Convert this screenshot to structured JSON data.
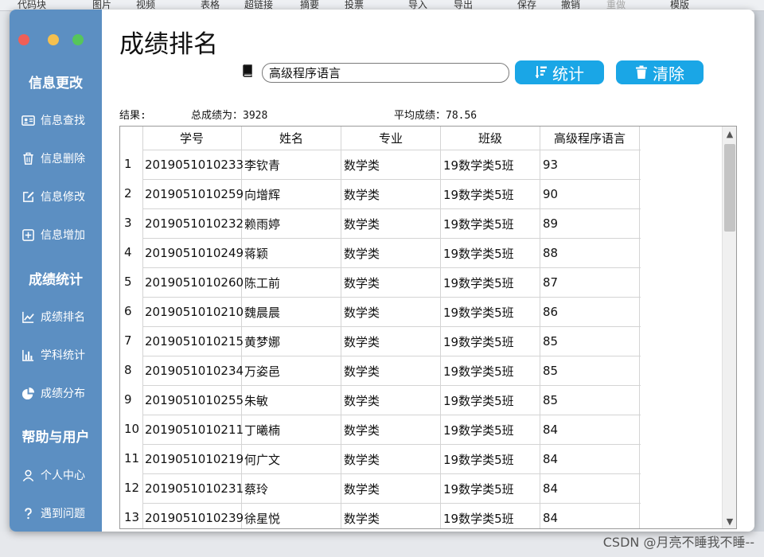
{
  "background": {
    "toolbar_items": [
      "代码块",
      "图片",
      "视频",
      "表格",
      "超链接",
      "摘要",
      "投票",
      "导入",
      "导出",
      "保存",
      "撤销",
      "重做",
      "模版"
    ],
    "watermark": "CSDN @月亮不睡我不睡--"
  },
  "window": {
    "title": "成绩排名",
    "sidebar": {
      "section_info": "信息更改",
      "info_items": [
        {
          "label": "信息查找",
          "icon": "id-card-icon"
        },
        {
          "label": "信息删除",
          "icon": "trash-icon"
        },
        {
          "label": "信息修改",
          "icon": "edit-icon"
        },
        {
          "label": "信息增加",
          "icon": "plus-square-icon"
        }
      ],
      "section_stats": "成绩统计",
      "stats_items": [
        {
          "label": "成绩排名",
          "icon": "line-chart-icon"
        },
        {
          "label": "学科统计",
          "icon": "bar-chart-icon"
        },
        {
          "label": "成绩分布",
          "icon": "pie-chart-icon"
        }
      ],
      "section_help": "帮助与用户",
      "help_items": [
        {
          "label": "个人中心",
          "icon": "user-icon"
        },
        {
          "label": "遇到问题",
          "icon": "question-icon"
        }
      ]
    },
    "toolbar": {
      "subject_value": "高级程序语言",
      "stat_button": "统计",
      "clear_button": "清除"
    },
    "summary": {
      "result_label": "结果:",
      "total_label": "总成绩为：3928",
      "avg_label": "平均成绩：78.56"
    },
    "table": {
      "columns": [
        "学号",
        "姓名",
        "专业",
        "班级",
        "高级程序语言"
      ],
      "rows": [
        {
          "num": "1",
          "id": "2019051010233",
          "name": "李钦青",
          "major": "数学类",
          "class": "19数学类5班",
          "score": "93"
        },
        {
          "num": "2",
          "id": "2019051010259",
          "name": "向增辉",
          "major": "数学类",
          "class": "19数学类5班",
          "score": "90"
        },
        {
          "num": "3",
          "id": "2019051010232",
          "name": "赖雨婷",
          "major": "数学类",
          "class": "19数学类5班",
          "score": "89"
        },
        {
          "num": "4",
          "id": "2019051010249",
          "name": "蒋颖",
          "major": "数学类",
          "class": "19数学类5班",
          "score": "88"
        },
        {
          "num": "5",
          "id": "2019051010260",
          "name": "陈工前",
          "major": "数学类",
          "class": "19数学类5班",
          "score": "87"
        },
        {
          "num": "6",
          "id": "2019051010210",
          "name": "魏晨晨",
          "major": "数学类",
          "class": "19数学类5班",
          "score": "86"
        },
        {
          "num": "7",
          "id": "2019051010215",
          "name": "黄梦娜",
          "major": "数学类",
          "class": "19数学类5班",
          "score": "85"
        },
        {
          "num": "8",
          "id": "2019051010234",
          "name": "万姿邑",
          "major": "数学类",
          "class": "19数学类5班",
          "score": "85"
        },
        {
          "num": "9",
          "id": "2019051010255",
          "name": "朱敏",
          "major": "数学类",
          "class": "19数学类5班",
          "score": "85"
        },
        {
          "num": "10",
          "id": "2019051010211",
          "name": "丁曦楠",
          "major": "数学类",
          "class": "19数学类5班",
          "score": "84"
        },
        {
          "num": "11",
          "id": "2019051010219",
          "name": "何广文",
          "major": "数学类",
          "class": "19数学类5班",
          "score": "84"
        },
        {
          "num": "12",
          "id": "2019051010231",
          "name": "蔡玲",
          "major": "数学类",
          "class": "19数学类5班",
          "score": "84"
        },
        {
          "num": "13",
          "id": "2019051010239",
          "name": "徐星悦",
          "major": "数学类",
          "class": "19数学类5班",
          "score": "84"
        }
      ]
    }
  },
  "colors": {
    "sidebar": "#5c8fc2",
    "button": "#1aa6e6"
  }
}
